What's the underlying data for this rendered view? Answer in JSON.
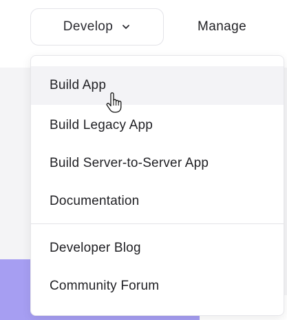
{
  "nav": {
    "develop_label": "Develop",
    "manage_label": "Manage"
  },
  "menu": {
    "items": [
      {
        "label": "Build App"
      },
      {
        "label": "Build Legacy App"
      },
      {
        "label": "Build Server-to-Server App"
      },
      {
        "label": "Documentation"
      },
      {
        "label": "Developer Blog"
      },
      {
        "label": "Community Forum"
      }
    ],
    "hovered_item": "Build App"
  },
  "icons": {
    "develop_chevron": "chevron-down-icon",
    "cursor": "hand-pointer-icon"
  },
  "colors": {
    "menu_hover_bg": "#f3f3f6",
    "page_accent": "#a69ef2"
  }
}
